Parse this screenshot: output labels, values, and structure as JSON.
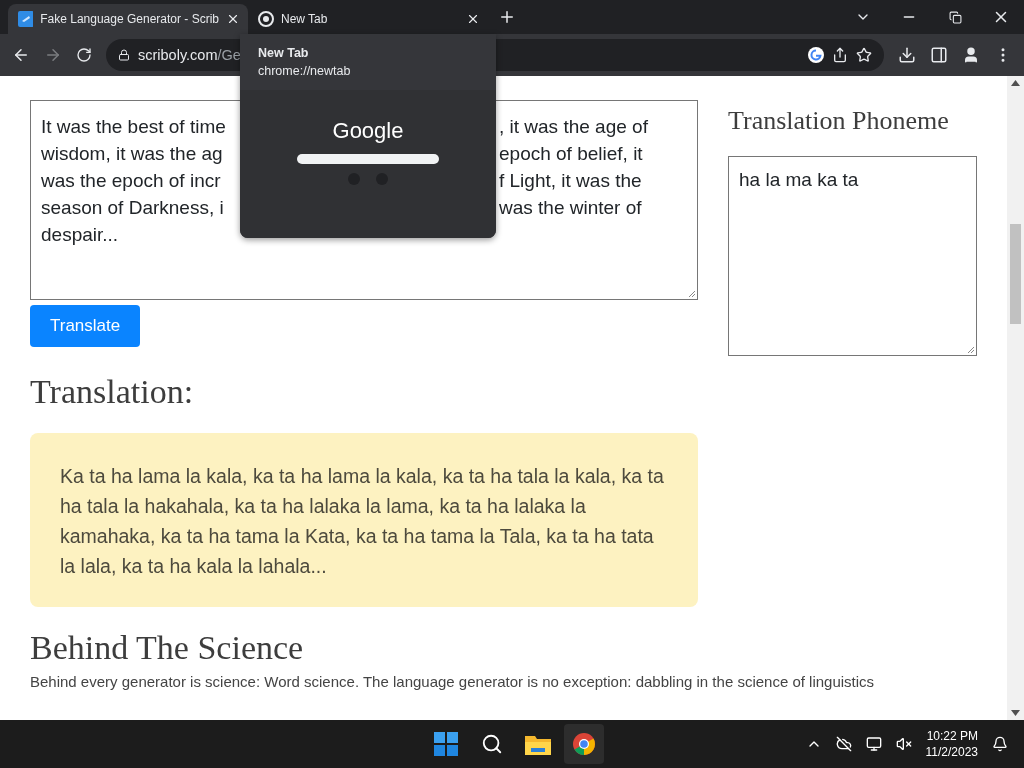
{
  "browser": {
    "tabs": [
      {
        "title": "Fake Language Generator - Scrib",
        "selected": true,
        "kind": "site"
      },
      {
        "title": "New Tab",
        "selected": false,
        "kind": "chrome"
      }
    ],
    "address": {
      "host": "scriboly.com",
      "path": "/Ge"
    }
  },
  "hover_card": {
    "title": "New Tab",
    "url": "chrome://newtab",
    "preview_logo": "Google"
  },
  "page": {
    "input_lines": [
      {
        "left": "It was the best of time",
        "right": ", it was the age of"
      },
      {
        "left": "wisdom, it was the ag",
        "right": "epoch of belief, it"
      },
      {
        "left": "was the epoch of incr",
        "right": "f Light, it was the"
      },
      {
        "left": "season of Darkness, i",
        "right": "was the winter of"
      },
      {
        "left": "despair..."
      }
    ],
    "translate_button": "Translate",
    "translation_heading": "Translation:",
    "translation": "Ka ta ha lama la kala, ka ta ha lama la kala, ka ta ha tala la kala, ka ta ha tala la hakahala, ka ta ha lalaka la lama, ka ta ha lalaka la kamahaka, ka ta ha tama la Kata, ka ta ha tama la Tala, ka ta ha tata la lala, ka ta ha kala la lahala...",
    "science_heading": "Behind The Science",
    "science_text": "Behind every generator is science: Word science. The language generator is no exception: dabbling in the science of linguistics",
    "phoneme_heading": "Translation Phoneme",
    "phoneme": "ha la ma ka ta"
  },
  "taskbar": {
    "time": "10:22 PM",
    "date": "11/2/2023"
  }
}
